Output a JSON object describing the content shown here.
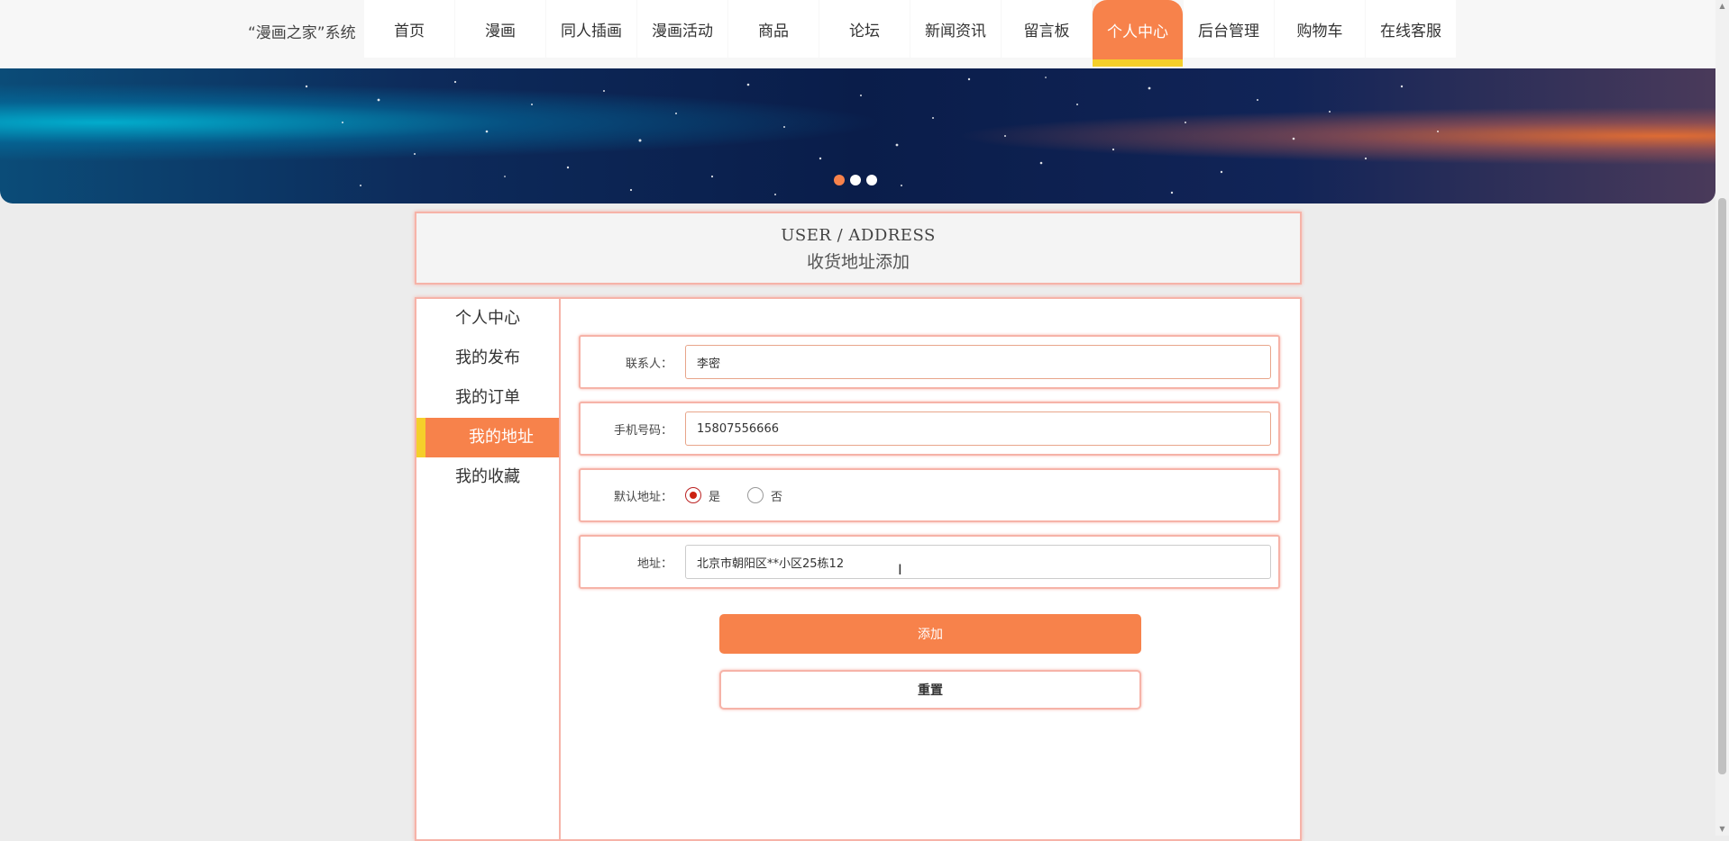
{
  "brand": "“漫画之家”系统",
  "nav": {
    "items": [
      {
        "label": "首页"
      },
      {
        "label": "漫画"
      },
      {
        "label": "同人插画"
      },
      {
        "label": "漫画活动"
      },
      {
        "label": "商品"
      },
      {
        "label": "论坛"
      },
      {
        "label": "新闻资讯"
      },
      {
        "label": "留言板"
      },
      {
        "label": "个人中心"
      },
      {
        "label": "后台管理"
      },
      {
        "label": "购物车"
      },
      {
        "label": "在线客服"
      }
    ],
    "active_index": 8
  },
  "banner": {
    "active_dot": 0,
    "dot_count": 3
  },
  "page_title": {
    "en": "USER / ADDRESS",
    "zh": "收货地址添加"
  },
  "sidebar": {
    "items": [
      {
        "label": "个人中心"
      },
      {
        "label": "我的发布"
      },
      {
        "label": "我的订单"
      },
      {
        "label": "我的地址"
      },
      {
        "label": "我的收藏"
      }
    ],
    "active_index": 3
  },
  "form": {
    "contact": {
      "label": "联系人：",
      "value": "李密"
    },
    "phone": {
      "label": "手机号码：",
      "value": "15807556666"
    },
    "default_address": {
      "label": "默认地址：",
      "options": [
        "是",
        "否"
      ],
      "selected": "是"
    },
    "address": {
      "label": "地址：",
      "value": "北京市朝阳区**小区25栋12"
    },
    "add_button": "添加",
    "reset_button": "重置"
  },
  "colors": {
    "accent": "#f7824b",
    "highlight": "#f5cf2a",
    "border": "#f6b3a8"
  }
}
